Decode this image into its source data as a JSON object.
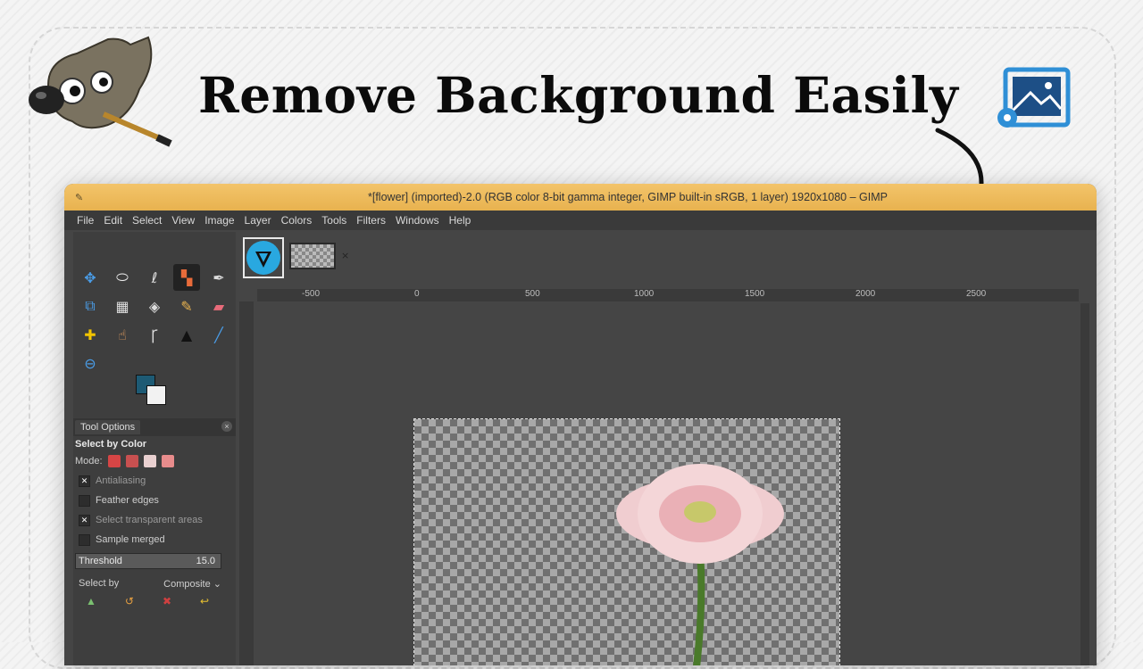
{
  "headline": "Remove Background Easily",
  "window": {
    "title": "*[flower] (imported)-2.0 (RGB color 8-bit gamma integer, GIMP built-in sRGB, 1 layer) 1920x1080 – GIMP"
  },
  "menu": [
    "File",
    "Edit",
    "Select",
    "View",
    "Image",
    "Layer",
    "Colors",
    "Tools",
    "Filters",
    "Windows",
    "Help"
  ],
  "tools": [
    "move-icon",
    "ellipse-select-icon",
    "free-select-icon",
    "select-by-color-icon",
    "paths-icon",
    "fill-icon",
    "crop-icon",
    "warp-icon",
    "clone-icon",
    "paint-icon",
    "eraser-icon",
    "blank",
    "heal-icon",
    "smudge-icon",
    "text-icon",
    "dodge-icon",
    "pick-icon",
    "blank",
    "zoom-icon"
  ],
  "colors": {
    "foreground": "#1d5a74",
    "background": "#f2f2f2",
    "accent": "#e8b24f"
  },
  "tool_options": {
    "tab_label": "Tool Options",
    "tool_name": "Select by Color",
    "mode_label": "Mode:",
    "antialiasing": "Antialiasing",
    "feather_edges": "Feather edges",
    "select_transparent": "Select transparent areas",
    "sample_merged": "Sample merged",
    "threshold_label": "Threshold",
    "threshold_value": "15.0",
    "select_by_label": "Select by",
    "select_by_value": "Composite"
  },
  "ruler": [
    "-500",
    "0",
    "500",
    "1000",
    "1500",
    "2000",
    "2500"
  ]
}
